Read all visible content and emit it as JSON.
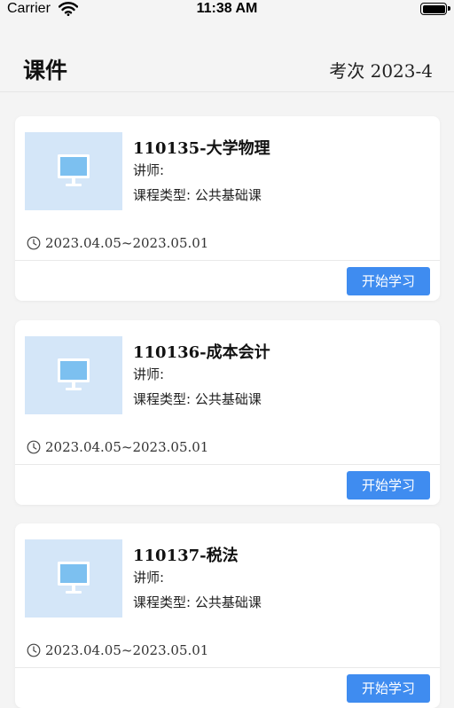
{
  "status_bar": {
    "carrier": "Carrier",
    "time": "11:38 AM"
  },
  "header": {
    "title": "课件",
    "exam_label": "考次 2023-4"
  },
  "courses": [
    {
      "title": "110135-大学物理",
      "lecturer": "讲师:",
      "type": "课程类型: 公共基础课",
      "date": "2023.04.05~2023.05.01",
      "button": "开始学习"
    },
    {
      "title": "110136-成本会计",
      "lecturer": "讲师:",
      "type": "课程类型: 公共基础课",
      "date": "2023.04.05~2023.05.01",
      "button": "开始学习"
    },
    {
      "title": "110137-税法",
      "lecturer": "讲师:",
      "type": "课程类型: 公共基础课",
      "date": "2023.04.05~2023.05.01",
      "button": "开始学习"
    }
  ],
  "colors": {
    "accent": "#3f8cf0",
    "thumb_bg": "#d4e6f8",
    "page_bg": "#f4f4f4"
  },
  "icons": {
    "thumbnail": "monitor-icon",
    "date": "clock-icon",
    "wifi": "wifi-icon",
    "battery": "battery-icon"
  }
}
